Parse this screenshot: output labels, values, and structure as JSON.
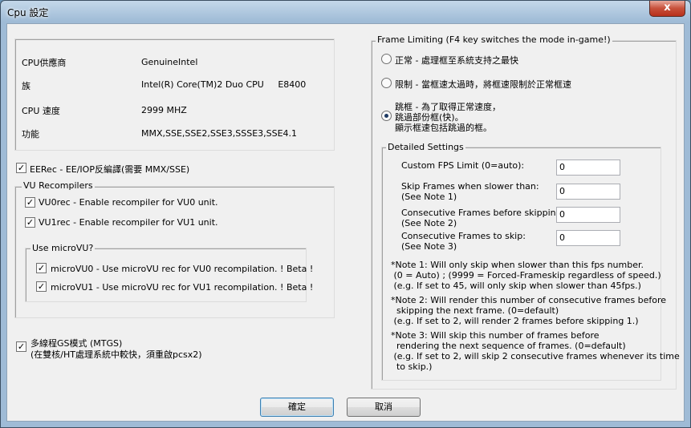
{
  "window": {
    "title": "Cpu 設定",
    "close_label": "x"
  },
  "cpu_info": {
    "rows": [
      {
        "label": "CPU供應商",
        "value": "GenuineIntel"
      },
      {
        "label": "族",
        "value": "Intel(R) Core(TM)2 Duo CPU     E8400"
      },
      {
        "label": "CPU 速度",
        "value": "2999 MHZ"
      },
      {
        "label": "功能",
        "value": "MMX,SSE,SSE2,SSE3,SSSE3,SSE4.1"
      }
    ]
  },
  "eerec": {
    "label": "EERec -  EE/IOP反編譯(需要 MMX/SSE)",
    "checked": true,
    "mark": "✓"
  },
  "vu_recompilers": {
    "title": "VU Recompilers",
    "vu0rec": {
      "label": "VU0rec - Enable recompiler for VU0 unit.",
      "checked": true
    },
    "vu1rec": {
      "label": "VU1rec - Enable recompiler for VU1 unit.",
      "checked": true
    },
    "microvu": {
      "title": "Use microVU?",
      "vu0": {
        "label": "microVU0 - Use microVU rec for VU0 recompilation. ! Beta !",
        "checked": true
      },
      "vu1": {
        "label": "microVU1 - Use microVU rec for VU1 recompilation. ! Beta !",
        "checked": true
      }
    }
  },
  "mtgs": {
    "line1": "多線程GS模式 (MTGS)",
    "line2": "(在雙核/HT處理系統中較快，須重啟pcsx2)",
    "checked": true
  },
  "frame_limiting": {
    "title": "Frame Limiting (F4 key switches the mode in-game!)",
    "options": [
      {
        "lines": [
          "正常 - 處理框至系統支持之最快"
        ],
        "selected": false
      },
      {
        "lines": [
          "限制 - 當框速太過時，將框速限制於正常框速"
        ],
        "selected": false
      },
      {
        "lines": [
          "跳框 - 為了取得正常速度，",
          "跳過部份框(快)。",
          "顯示框速包括跳過的框。"
        ],
        "selected": true
      }
    ]
  },
  "detailed": {
    "title": "Detailed Settings",
    "fields": [
      {
        "lines": [
          "Custom FPS Limit (0=auto):"
        ],
        "value": "0"
      },
      {
        "lines": [
          "Skip Frames when slower than:",
          "(See Note 1)"
        ],
        "value": "0"
      },
      {
        "lines": [
          "Consecutive Frames before skipping:",
          "(See Note 2)"
        ],
        "value": "0"
      },
      {
        "lines": [
          "Consecutive Frames to skip:",
          "(See Note 3)"
        ],
        "value": "0"
      }
    ],
    "notes": [
      [
        "*Note 1: Will only skip when slower than this fps number.",
        " (0 = Auto) ; (9999 = Forced-Frameskip regardless of speed.)",
        " (e.g. If set to 45, will only skip when slower than 45fps.)"
      ],
      [
        "*Note 2: Will render this number of consecutive frames before",
        "  skipping the next frame. (0=default)",
        " (e.g. If set to 2, will render 2 frames before skipping 1.)"
      ],
      [
        "*Note 3: Will skip this number of frames before",
        "  rendering the next sequence of frames. (0=default)",
        " (e.g. If set to 2, will skip 2 consecutive frames whenever its time",
        "  to skip.)"
      ]
    ]
  },
  "buttons": {
    "ok": "確定",
    "cancel": "取消"
  }
}
